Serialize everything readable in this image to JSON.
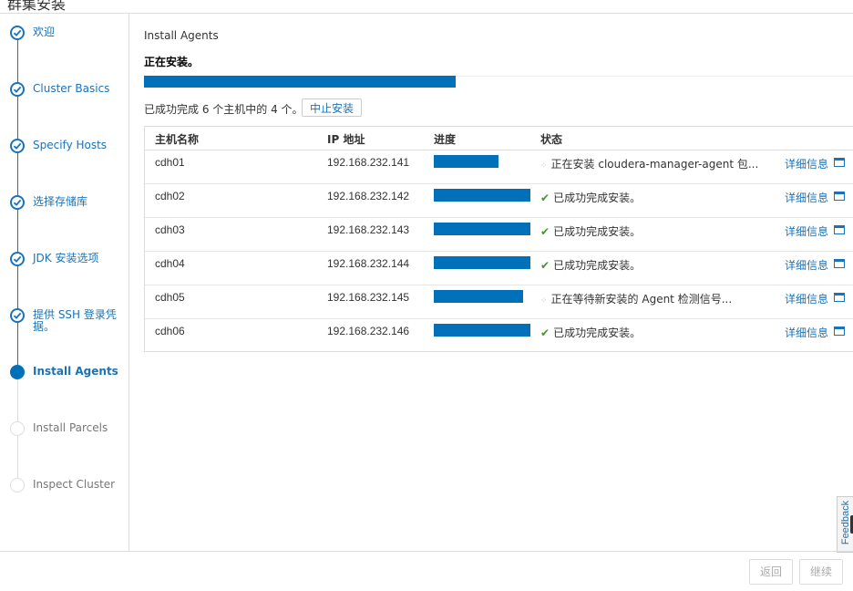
{
  "window": {
    "title_fragment": "群集安装"
  },
  "steps": [
    {
      "label": "欢迎",
      "state": "done"
    },
    {
      "label": "Cluster Basics",
      "state": "done"
    },
    {
      "label": "Specify Hosts",
      "state": "done"
    },
    {
      "label": "选择存储库",
      "state": "done"
    },
    {
      "label": "JDK 安装选项",
      "state": "done"
    },
    {
      "label": "提供 SSH 登录凭据。",
      "state": "done"
    },
    {
      "label": "Install Agents",
      "state": "active"
    },
    {
      "label": "Install Parcels",
      "state": "pending"
    },
    {
      "label": "Inspect Cluster",
      "state": "pending"
    }
  ],
  "main": {
    "title": "Install Agents",
    "subtitle": "正在安装。",
    "overall_progress": 0.44,
    "summary": "已成功完成 6 个主机中的 4 个。",
    "abort_label": "中止安装"
  },
  "table": {
    "headers": {
      "host": "主机名称",
      "ip": "IP 地址",
      "progress": "进度",
      "status": "状态"
    },
    "rows": [
      {
        "host": "cdh01",
        "ip": "192.168.232.141",
        "progress": 0.67,
        "state": "running",
        "status": "正在安装 cloudera-manager-agent 包...",
        "detail": "详细信息"
      },
      {
        "host": "cdh02",
        "ip": "192.168.232.142",
        "progress": 1.0,
        "state": "ok",
        "status": "已成功完成安装。",
        "detail": "详细信息"
      },
      {
        "host": "cdh03",
        "ip": "192.168.232.143",
        "progress": 1.0,
        "state": "ok",
        "status": "已成功完成安装。",
        "detail": "详细信息"
      },
      {
        "host": "cdh04",
        "ip": "192.168.232.144",
        "progress": 1.0,
        "state": "ok",
        "status": "已成功完成安装。",
        "detail": "详细信息"
      },
      {
        "host": "cdh05",
        "ip": "192.168.232.145",
        "progress": 0.92,
        "state": "running",
        "status": "正在等待新安装的 Agent 检测信号...",
        "detail": "详细信息"
      },
      {
        "host": "cdh06",
        "ip": "192.168.232.146",
        "progress": 1.0,
        "state": "ok",
        "status": "已成功完成安装。",
        "detail": "详细信息"
      }
    ]
  },
  "footer": {
    "back_label": "返回",
    "continue_label": "继续"
  },
  "feedback_label": "Feedback",
  "colors": {
    "accent": "#0070b8",
    "link": "#1a73b8",
    "success": "#3c9a29"
  }
}
